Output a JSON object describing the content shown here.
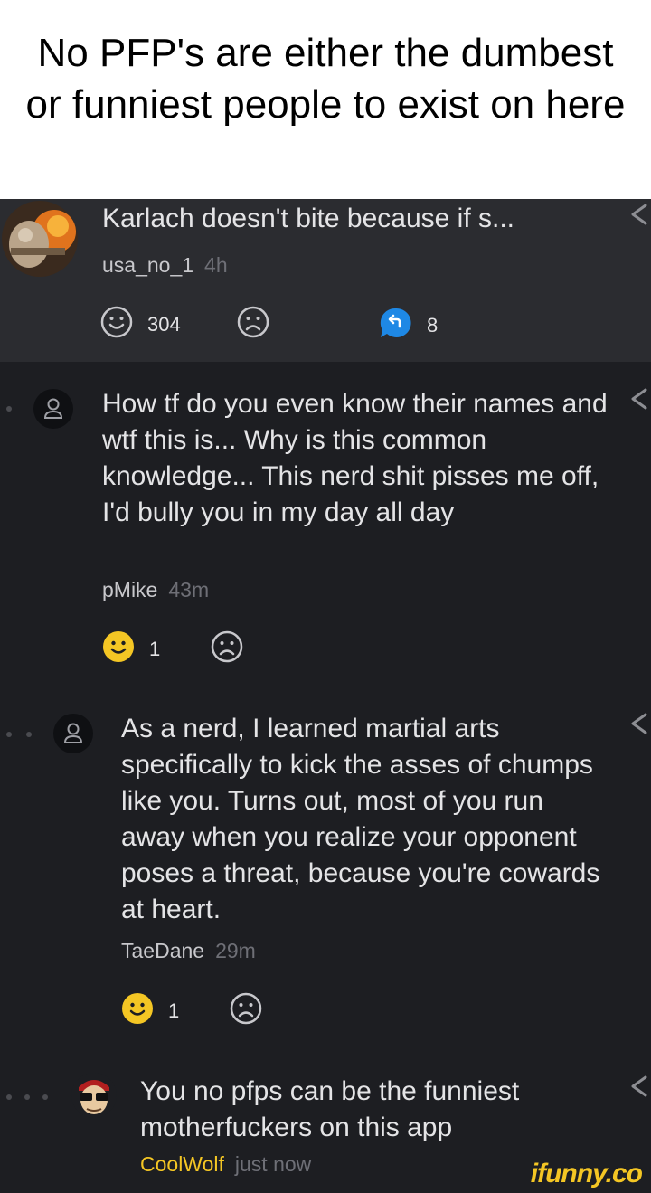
{
  "caption": "No PFP's are either the dumbest or funniest people to exist on here",
  "top_comment": {
    "text": "Karlach doesn't bite because if s...",
    "author": "usa_no_1",
    "time": "4h",
    "smiles": "304",
    "replies": "8"
  },
  "comments": [
    {
      "text": "How tf do you even know their names and wtf this is... Why is this common knowledge... This nerd shit pisses me off, I'd bully you in my day all day",
      "author": "pMike",
      "time": "43m",
      "smiles": "1"
    },
    {
      "text": "As a nerd, I learned martial arts specifically to kick the asses of chumps like you. Turns out, most of you run away when you realize your opponent poses a threat, because you're cowards at heart.",
      "author": "TaeDane",
      "time": "29m",
      "smiles": "1"
    },
    {
      "text": "You no pfps can be the funniest motherfuckers on this app",
      "author": "CoolWolf",
      "time": "just now"
    }
  ],
  "watermark": "ifunny.co",
  "colors": {
    "accent": "#f4c624",
    "reply_badge": "#1e88e5",
    "background": "#1d1e22"
  }
}
